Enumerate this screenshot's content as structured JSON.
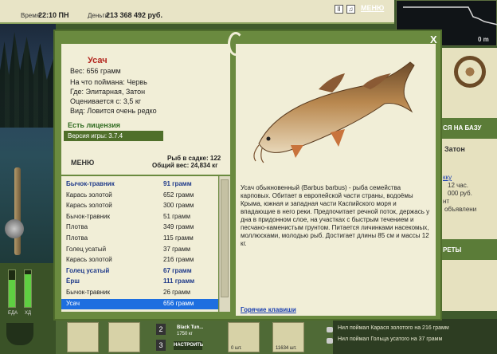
{
  "topbar": {
    "time_label": "Время:",
    "time_value": "22:10 ПН",
    "money_label": "Деньги:",
    "money_value": "213 368 492 руб.",
    "menu_label": "МЕНЮ",
    "icon_pause": "II",
    "icon_sound": "♫"
  },
  "minimap": {
    "left_label": "0 m",
    "right_label": "0 m"
  },
  "right_panel": {
    "base_label": "СЯ НА БАЗУ",
    "location": "Затон",
    "link": "кку",
    "line1": "12 час.",
    "line2": "000 руб.",
    "line3": "нт",
    "line4": "объявлени",
    "secrets_label": "РЕТЫ"
  },
  "gauges": {
    "left_label": "ЕДА",
    "right_label": "ХД"
  },
  "bottom": {
    "slot_num_2": "2",
    "slot_num_3": "3",
    "tackle_name": "Black Tun...",
    "tackle_weight": "1750 кг",
    "settings_label": "НАСТРОИТЬ",
    "hook_count": "0 шт.",
    "bait_count": "11634 шт."
  },
  "log": {
    "line1": "Нил поймал Карася золотого на 216 грамм",
    "line2": "Нил поймал Гольца усатого на 37 грамм"
  },
  "dialog": {
    "close_label": "X",
    "fish_name": "Усач",
    "weight": "Вес: 656 грамм",
    "caught_on": "На что поймана: Червь",
    "caught_where": "Где: Элитарная, Затон",
    "valued_from": "Оценивается с: 3,5 кг",
    "rarity": "Вид: Ловится очень редко",
    "license": "Есть лицензия",
    "version": "Версия игры: 3.7.4",
    "menu_label": "МЕНЮ",
    "keepnet_count": "Рыб в садке: 122",
    "keepnet_total": "Общий вес: 24,834 кг",
    "description": "Усач обыкновенный (Barbus barbus) - рыба семейства карповых. Обитает в европейской части страны, водоёмы Крыма, южная и западная части Каспийского моря и впадающие в него реки. Предпочитает речной поток, держась у дна в придонном слое, на участках с быстрым течением и песчано-каменистым грунтом. Питается личинками насекомых, моллюсками, молодью рыб. Достигает длины 85 см и массы 12 кг.",
    "hotkeys_label": "Горячие клавиши"
  },
  "catch_list": [
    {
      "name": "Бычок-травник",
      "weight": "91 грамм",
      "bold": true,
      "selected": false
    },
    {
      "name": "Карась золотой",
      "weight": "652 грамм",
      "bold": false,
      "selected": false
    },
    {
      "name": "Карась золотой",
      "weight": "300 грамм",
      "bold": false,
      "selected": false
    },
    {
      "name": "Бычок-травник",
      "weight": "51 грамм",
      "bold": false,
      "selected": false
    },
    {
      "name": "Плотва",
      "weight": "349 грамм",
      "bold": false,
      "selected": false
    },
    {
      "name": "Плотва",
      "weight": "115 грамм",
      "bold": false,
      "selected": false
    },
    {
      "name": "Голец усатый",
      "weight": "37 грамм",
      "bold": false,
      "selected": false
    },
    {
      "name": "Карась золотой",
      "weight": "216 грамм",
      "bold": false,
      "selected": false
    },
    {
      "name": "Голец усатый",
      "weight": "67 грамм",
      "bold": true,
      "selected": false
    },
    {
      "name": "Ёрш",
      "weight": "111 грамм",
      "bold": true,
      "selected": false
    },
    {
      "name": "Бычок-травник",
      "weight": "26 грамм",
      "bold": false,
      "selected": false
    },
    {
      "name": "Усач",
      "weight": "656 грамм",
      "bold": false,
      "selected": true
    }
  ],
  "colors": {
    "title_red": "#b3261e",
    "selected_blue": "#1d6ee0",
    "dialog_green": "#6a8a3f"
  },
  "gauge_levels": {
    "left": 0.75,
    "right": 0.9
  }
}
